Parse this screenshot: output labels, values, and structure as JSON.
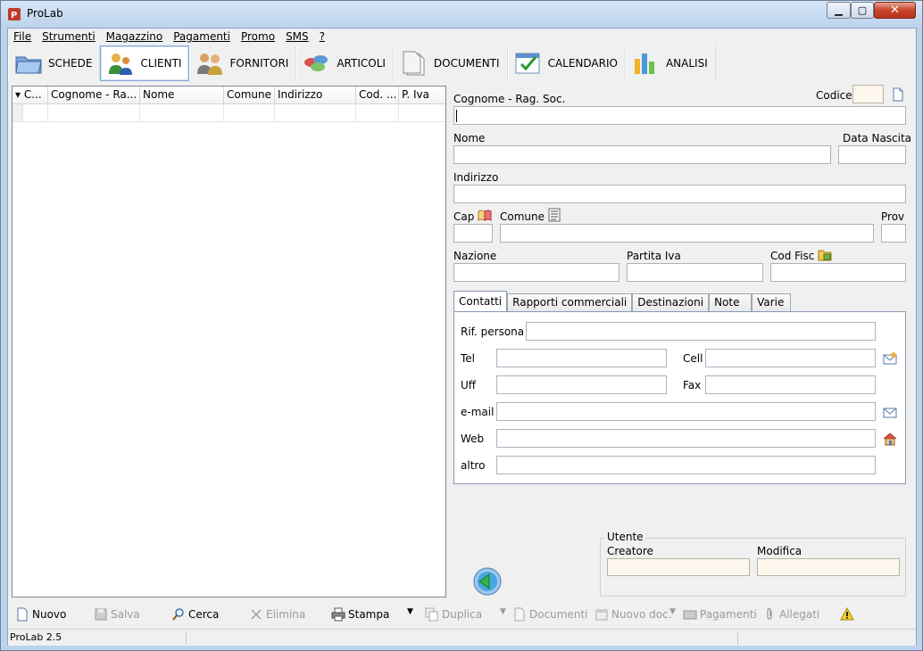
{
  "window": {
    "title": "ProLab"
  },
  "menu": [
    "File",
    "Strumenti",
    "Magazzino",
    "Pagamenti",
    "Promo",
    "SMS",
    "?"
  ],
  "toolbar": [
    {
      "label": "SCHEDE",
      "icon": "folder-icon"
    },
    {
      "label": "CLIENTI",
      "icon": "clients-icon",
      "active": true
    },
    {
      "label": "FORNITORI",
      "icon": "suppliers-icon"
    },
    {
      "label": "ARTICOLI",
      "icon": "articles-icon"
    },
    {
      "label": "DOCUMENTI",
      "icon": "documents-icon"
    },
    {
      "label": "CALENDARIO",
      "icon": "calendar-icon"
    },
    {
      "label": "ANALISI",
      "icon": "chart-icon"
    }
  ],
  "list": {
    "columns": [
      "C...",
      "Cognome - Ra...",
      "Nome",
      "Comune",
      "Indirizzo",
      "Cod. ...",
      "P. Iva"
    ],
    "rows": [
      [
        "",
        "",
        "",
        "",
        "",
        "",
        ""
      ]
    ]
  },
  "form": {
    "cognome_label": "Cognome - Rag. Soc.",
    "codice_label": "Codice",
    "nome_label": "Nome",
    "data_nascita_label": "Data Nascita",
    "indirizzo_label": "Indirizzo",
    "cap_label": "Cap",
    "comune_label": "Comune",
    "prov_label": "Prov",
    "nazione_label": "Nazione",
    "partita_iva_label": "Partita Iva",
    "cod_fisc_label": "Cod Fisc",
    "values": {
      "cognome": "",
      "codice": "",
      "nome": "",
      "data_nascita": "",
      "indirizzo": "",
      "cap": "",
      "comune": "",
      "prov": "",
      "nazione": "",
      "partita_iva": "",
      "cod_fisc": ""
    }
  },
  "tabs": [
    "Contatti",
    "Rapporti commerciali",
    "Destinazioni",
    "Note",
    "Varie"
  ],
  "contatti": {
    "rif_persona_label": "Rif. persona",
    "tel_label": "Tel",
    "cell_label": "Cell",
    "uff_label": "Uff",
    "fax_label": "Fax",
    "email_label": "e-mail",
    "web_label": "Web",
    "altro_label": "altro",
    "values": {
      "rif_persona": "",
      "tel": "",
      "cell": "",
      "uff": "",
      "fax": "",
      "email": "",
      "web": "",
      "altro": ""
    }
  },
  "utente": {
    "group_title": "Utente",
    "creatore_label": "Creatore",
    "modifica_label": "Modifica",
    "values": {
      "creatore": "",
      "modifica": ""
    }
  },
  "bottom": {
    "nuovo": "Nuovo",
    "salva": "Salva",
    "cerca": "Cerca",
    "elimina": "Elimina",
    "stampa": "Stampa",
    "duplica": "Duplica",
    "documenti": "Documenti",
    "nuovo_doc": "Nuovo doc.",
    "pagamenti": "Pagamenti",
    "allegati": "Allegati"
  },
  "status": {
    "version": "ProLab 2.5"
  },
  "colors": {
    "accent": "#3a7bd5",
    "active_tab_border": "#7fa8d8",
    "field_cream": "#fdf7ee"
  }
}
